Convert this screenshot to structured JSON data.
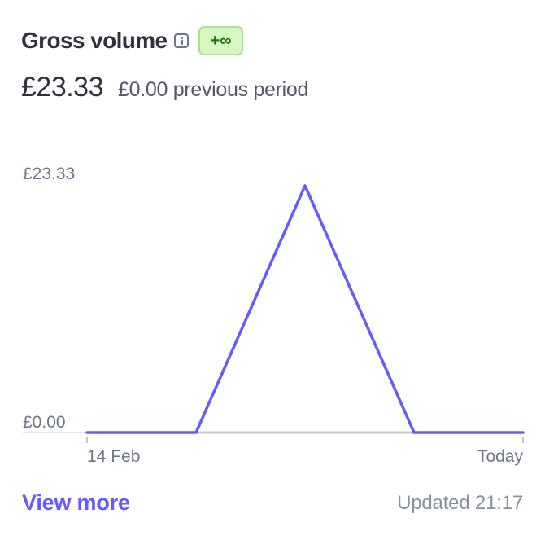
{
  "header": {
    "title": "Gross volume",
    "info_icon": "info-icon",
    "badge": "+∞"
  },
  "summary": {
    "amount": "£23.33",
    "previous": "£0.00 previous period"
  },
  "footer": {
    "view_more": "View more",
    "updated": "Updated 21:17"
  },
  "colors": {
    "line": "#635bff",
    "previous_line": "#c4c8cf",
    "badge_bg": "#d7f7c2",
    "badge_text": "#217005",
    "link": "#635bff"
  },
  "chart_data": {
    "type": "line",
    "x": [
      "14 Feb",
      "",
      "",
      "",
      "Today"
    ],
    "series": [
      {
        "values": [
          0,
          0,
          23.33,
          0,
          0
        ]
      },
      {
        "values": [
          0,
          0,
          0,
          0,
          0
        ]
      }
    ],
    "ylim": [
      0,
      23.33
    ],
    "ytick_labels": [
      "£23.33",
      "£0.00"
    ],
    "xtick_labels": [
      "14 Feb",
      "Today"
    ],
    "grid": false
  }
}
